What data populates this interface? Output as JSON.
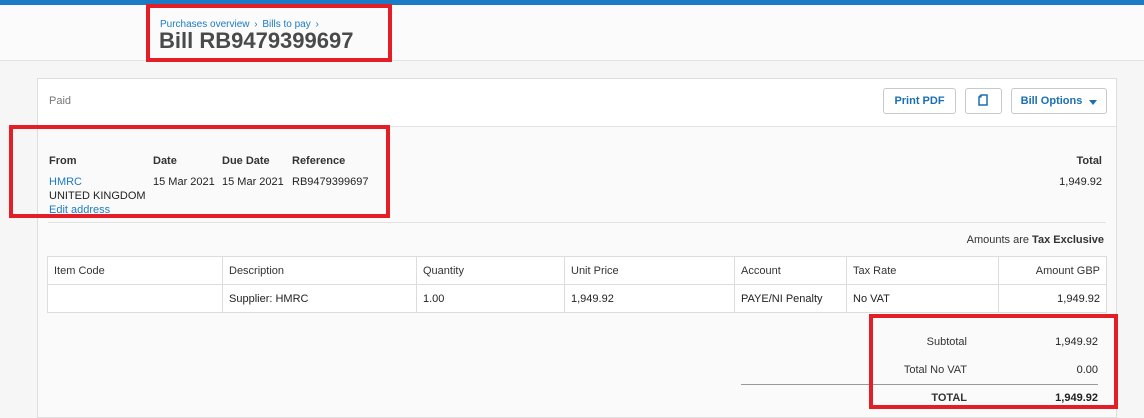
{
  "breadcrumb": {
    "item1": "Purchases overview",
    "sep1": "›",
    "item2": "Bills to pay",
    "sep2": "›"
  },
  "title": "Bill RB9479399697",
  "status": "Paid",
  "toolbar": {
    "print_label": "Print PDF",
    "copy_icon": "document-copy-icon",
    "options_label": "Bill Options"
  },
  "details": {
    "from_label": "From",
    "from_name": "HMRC",
    "from_country": "UNITED KINGDOM",
    "edit_address": "Edit address",
    "date_label": "Date",
    "date_value": "15 Mar 2021",
    "due_label": "Due Date",
    "due_value": "15 Mar 2021",
    "ref_label": "Reference",
    "ref_value": "RB9479399697",
    "total_label": "Total",
    "total_value": "1,949.92"
  },
  "amounts_note": {
    "prefix": "Amounts are",
    "mode": "Tax Exclusive"
  },
  "table": {
    "headers": [
      "Item Code",
      "Description",
      "Quantity",
      "Unit Price",
      "Account",
      "Tax Rate",
      "Amount GBP"
    ],
    "rows": [
      [
        "",
        "Supplier: HMRC",
        "1.00",
        "1,949.92",
        "PAYE/NI Penalty",
        "No VAT",
        "1,949.92"
      ]
    ]
  },
  "totals": {
    "subtotal_label": "Subtotal",
    "subtotal_value": "1,949.92",
    "vat_label": "Total No VAT",
    "vat_value": "0.00",
    "total_label": "TOTAL",
    "total_value": "1,949.92"
  },
  "colors": {
    "accent": "#1b7bc4",
    "highlight": "#e41e26"
  }
}
